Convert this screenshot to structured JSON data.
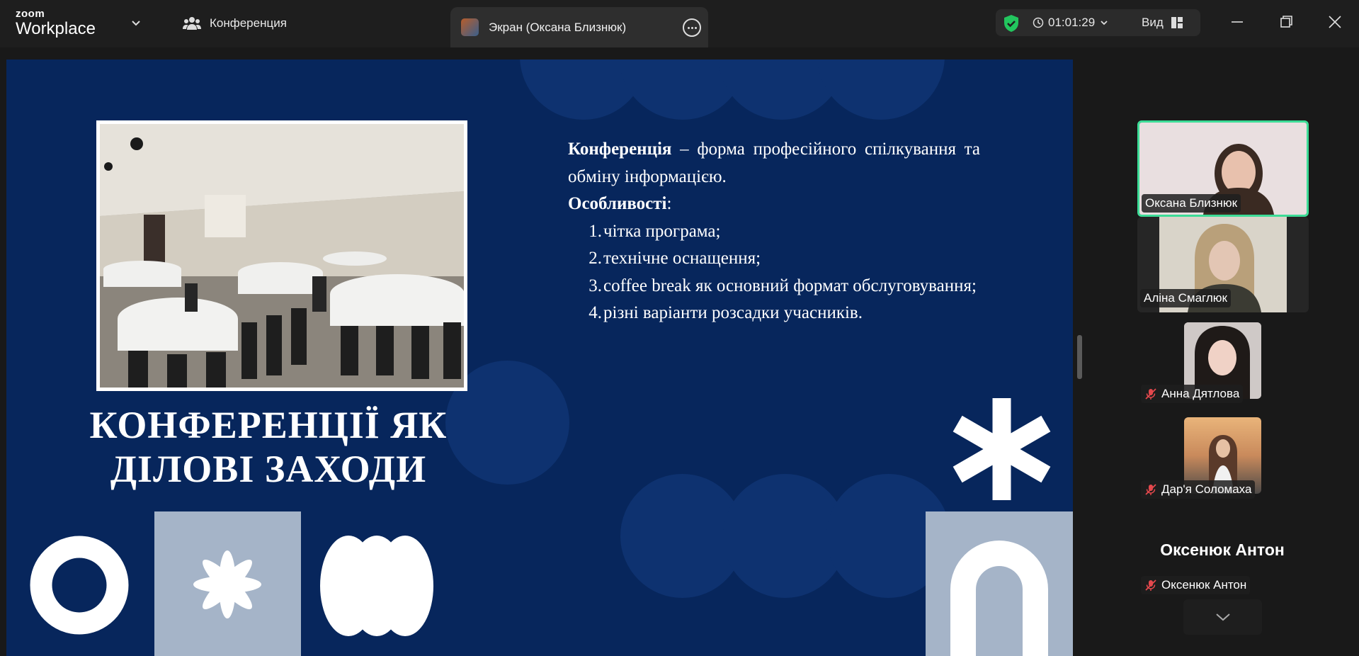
{
  "app": {
    "brand_top": "zoom",
    "brand_bottom": "Workplace"
  },
  "titlebar": {
    "conference_tab": "Конференция",
    "screen_tab": "Экран (Оксана Близнюк)",
    "timer": "01:01:29",
    "view_label": "Вид"
  },
  "slide": {
    "title_line1": "КОНФЕРЕНЦІЇ ЯК",
    "title_line2": "ДІЛОВІ ЗАХОДИ",
    "definition_term": "Конференція",
    "definition_rest": " – форма професійного спілкування та обміну інформацією.",
    "features_heading": "Особливості",
    "features_colon": ":",
    "features": [
      {
        "num": "1.",
        "text": "чітка програма;"
      },
      {
        "num": "2.",
        "text": "технічне оснащення;"
      },
      {
        "num": "3.",
        "text": "coffee break як основний формат обслуговування;"
      },
      {
        "num": "4.",
        "text": "різні варіанти розсадки учасників."
      }
    ]
  },
  "participants": [
    {
      "name": "Оксана Близнюк",
      "muted": false,
      "active": true
    },
    {
      "name": "Аліна Смаглюк",
      "muted": false,
      "active": false
    },
    {
      "name": "Анна Дятлова",
      "muted": true,
      "active": false
    },
    {
      "name": "Дар'я Соломаха",
      "muted": true,
      "active": false
    },
    {
      "name": "Оксенюк Антон",
      "muted": true,
      "active": false
    }
  ],
  "no_video_name": "Оксенюк Антон",
  "colors": {
    "slide_bg": "#07265c",
    "active_border": "#3ddc97",
    "muted_red": "#e5484d",
    "shield_green": "#22c55e"
  }
}
